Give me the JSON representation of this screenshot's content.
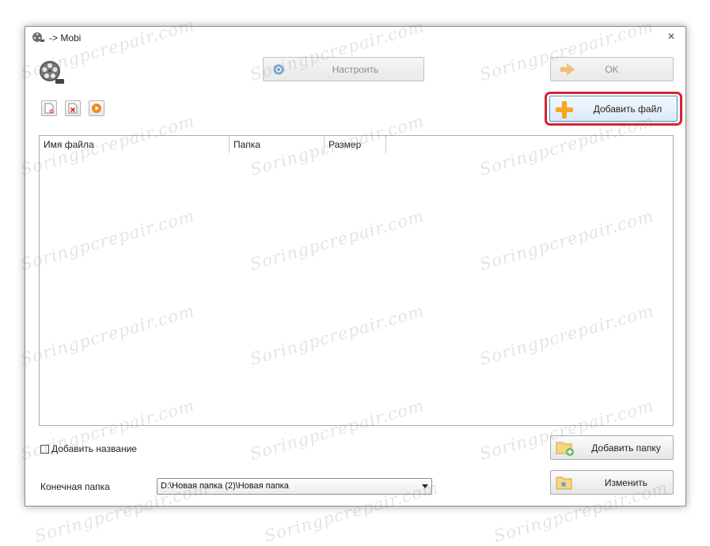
{
  "window": {
    "title": "-> Mobi",
    "close_glyph": "×"
  },
  "toolbar": {
    "configure_label": "Настроить",
    "ok_label": "OK",
    "add_file_label": "Добавить файл"
  },
  "file_list": {
    "columns": [
      "Имя файла",
      "Папка",
      "Размер"
    ]
  },
  "options": {
    "add_title_label": "Добавить название",
    "add_title_checked": false
  },
  "folder": {
    "add_folder_label": "Добавить папку",
    "destination_label": "Конечная папка",
    "destination_value": "D:\\Новая папка (2)\\Новая папка",
    "change_label": "Изменить"
  },
  "watermark": {
    "text": "Soringpcrepair.com"
  },
  "icons": {
    "title": "film-reel-icon",
    "app": "film-reel-icon",
    "configure": "gear-icon",
    "ok": "arrow-right-icon",
    "add_file": "plus-icon",
    "remove": "document-minus-icon",
    "clear": "document-x-icon",
    "play": "play-icon",
    "add_folder": "folder-plus-icon",
    "change": "folder-icon"
  },
  "colors": {
    "highlight": "#d8232a",
    "plus": "#f5a623",
    "ok_arrow": "#f3b45e"
  }
}
